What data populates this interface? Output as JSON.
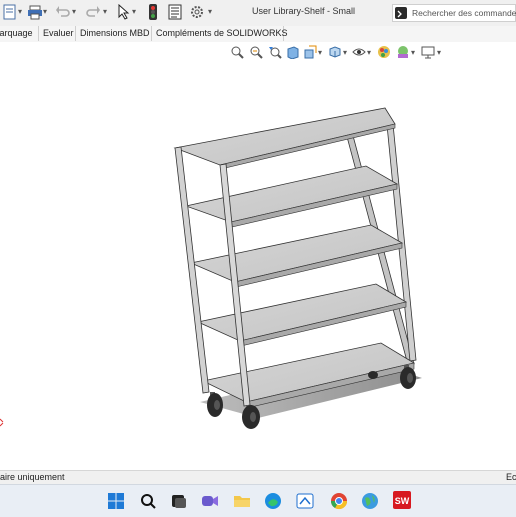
{
  "window": {
    "title": "User Library-Shelf - Small"
  },
  "quick_access": {
    "icons": [
      "document-icon",
      "print-icon",
      "undo-icon",
      "redo-icon",
      "select-cursor-icon",
      "traffic-light-icon",
      "file-properties-icon",
      "gear-icon"
    ]
  },
  "search": {
    "placeholder": "Rechercher des commandes"
  },
  "tabs": [
    {
      "label": "Marquage"
    },
    {
      "label": "Evaluer"
    },
    {
      "label": "Dimensions MBD"
    },
    {
      "label": "Compléments de SOLIDWORKS"
    }
  ],
  "view_toolbar": {
    "icons": [
      "zoom-to-fit-icon",
      "zoom-area-icon",
      "previous-view-icon",
      "section-view-icon",
      "view-orientation-icon",
      "display-style-icon",
      "hide-show-icon",
      "appearance-icon",
      "scene-icon",
      "display-settings-icon"
    ]
  },
  "model": {
    "name": "Shelf - Small",
    "frame_color": "#c8c8c8",
    "wheel_color": "#2a2a2a"
  },
  "status": {
    "left_text": "aire uniquement",
    "right_text": "Ec"
  },
  "taskbar": {
    "icons": [
      "windows-start-icon",
      "search-icon",
      "task-view-icon",
      "meet-icon",
      "file-explorer-icon",
      "edge-icon",
      "whiteboard-icon",
      "chrome-icon",
      "globe-app-icon",
      "solidworks-icon"
    ]
  }
}
